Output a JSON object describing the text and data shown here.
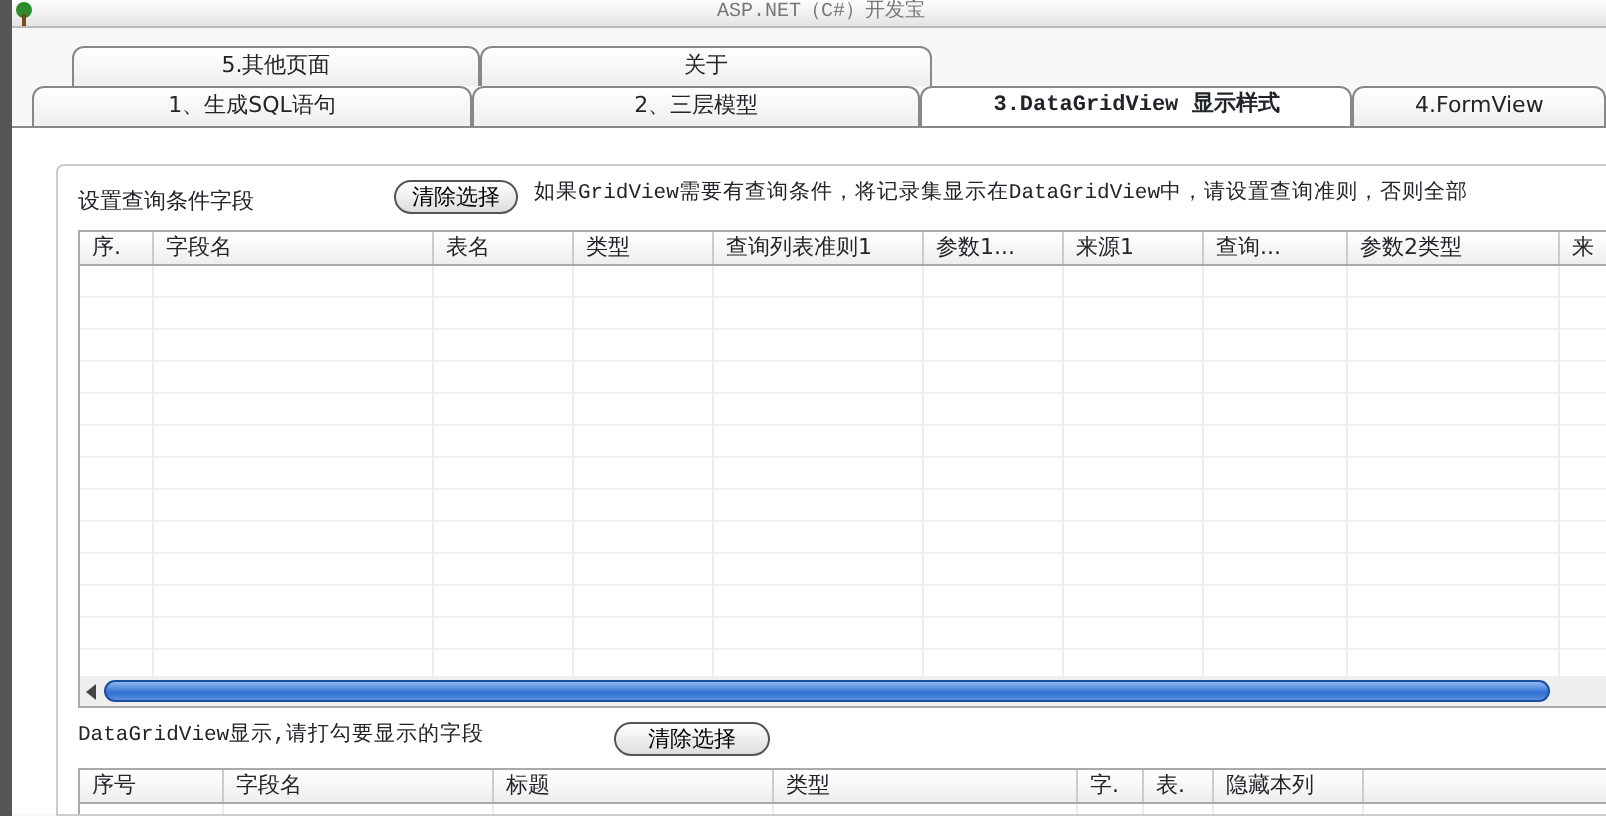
{
  "window": {
    "title": "ASP.NET（C#）开发宝"
  },
  "tab_rows": [
    [
      {
        "label": "5.其他页面",
        "selected": false
      },
      {
        "label": "关于",
        "selected": false
      }
    ],
    [
      {
        "label": "1、生成SQL语句",
        "selected": false
      },
      {
        "label": "2、三层模型",
        "selected": false
      },
      {
        "label": "3.DataGridView 显示样式",
        "selected": true
      },
      {
        "label": "4.FormView",
        "selected": false
      }
    ]
  ],
  "query_section": {
    "label": "设置查询条件字段",
    "clear_button": "清除选择",
    "hint": "如果GridView需要有查询条件，将记录集显示在DataGridView中，请设置查询准则，否则全部",
    "table": {
      "columns": [
        "序.",
        "字段名",
        "表名",
        "类型",
        "查询列表准则1",
        "参数1...",
        "来源1",
        "查询...",
        "参数2类型",
        "来"
      ]
    }
  },
  "display_section": {
    "label": "DataGridView显示,请打勾要显示的字段",
    "clear_button": "清除选择",
    "table": {
      "columns": [
        "序号",
        "字段名",
        "标题",
        "类型",
        "字.",
        "表.",
        "隐藏本列",
        ""
      ]
    }
  }
}
